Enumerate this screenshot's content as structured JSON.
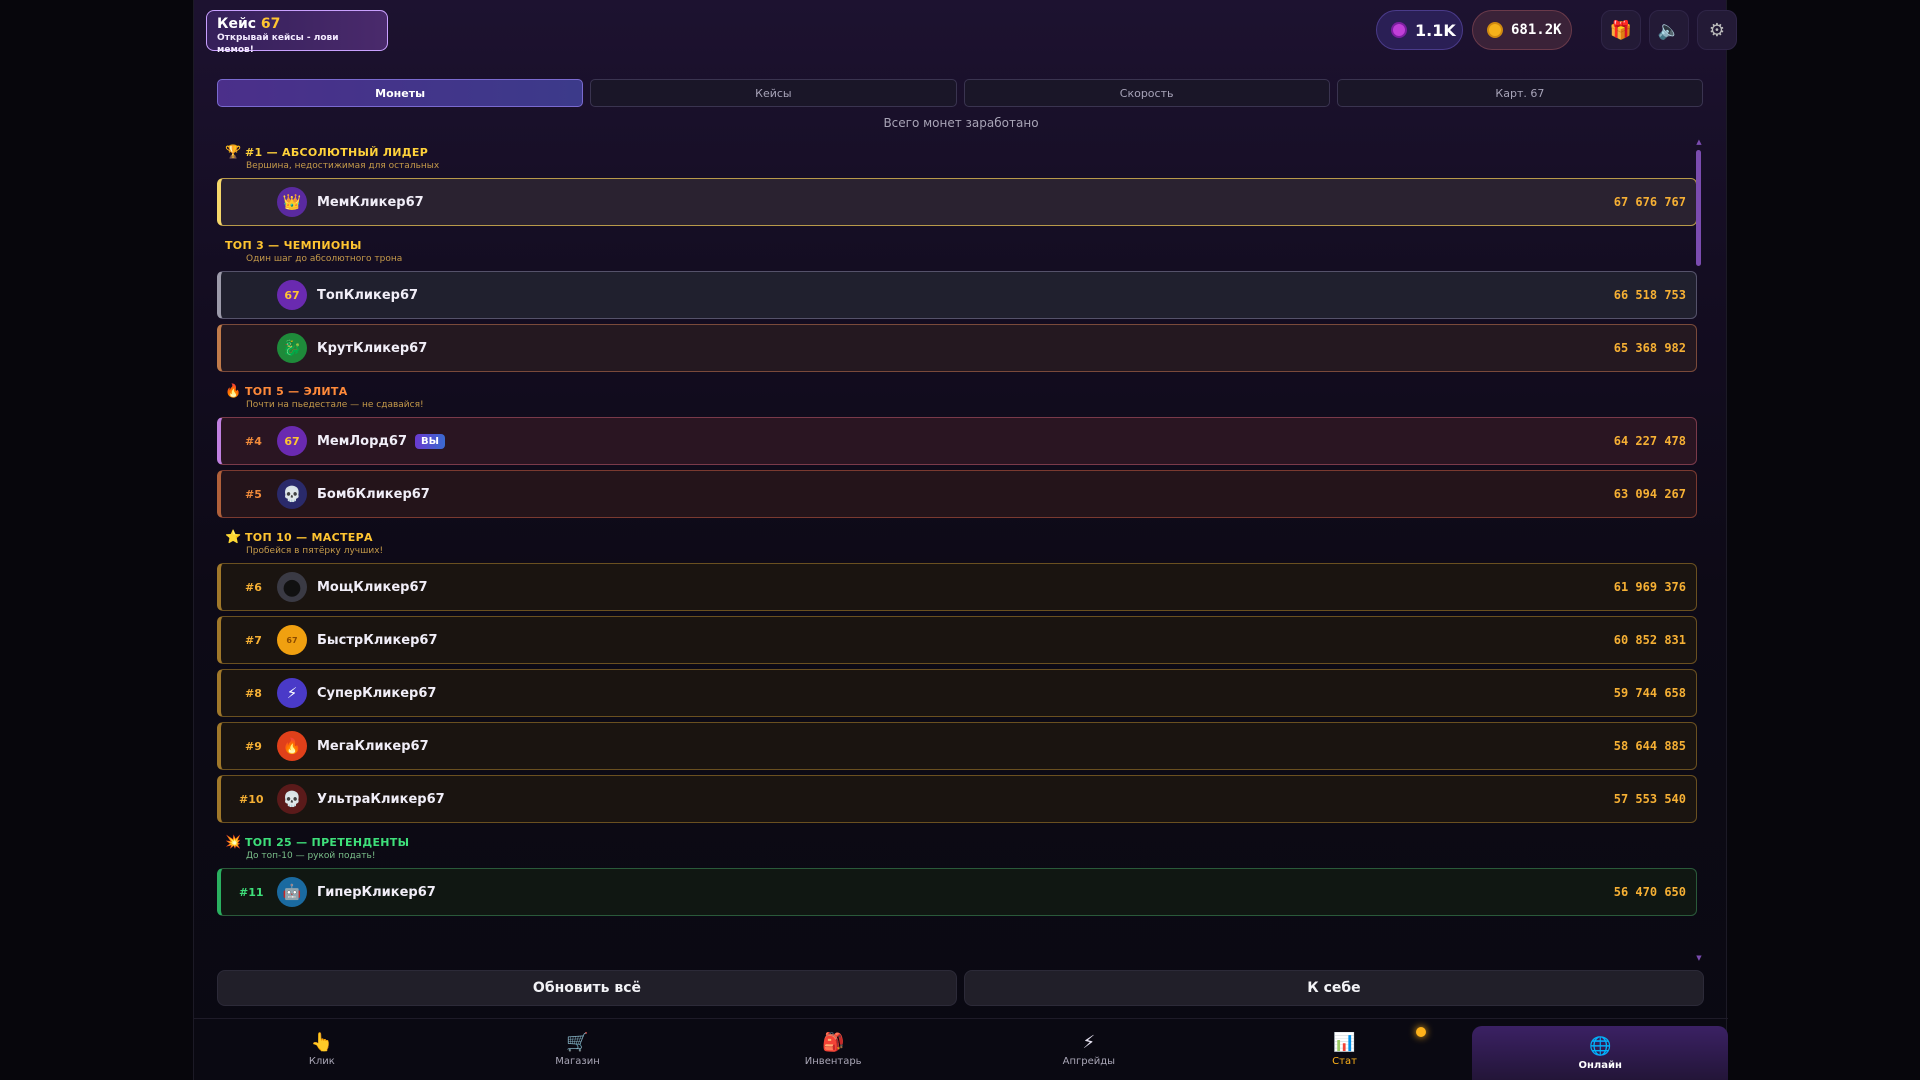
{
  "brand": {
    "title": "Кейс",
    "number": "67",
    "tagline": "Открывай кейсы - лови мемов!"
  },
  "header": {
    "gems": "1.1K",
    "coins": "681.2K"
  },
  "tabs": [
    {
      "label": "Монеты",
      "active": true
    },
    {
      "label": "Кейсы",
      "active": false
    },
    {
      "label": "Скорость",
      "active": false
    },
    {
      "label": "Карт. 67",
      "active": false
    }
  ],
  "subtitle": "Всего монет заработано",
  "groups": [
    {
      "title": "#1 — АБСОЛЮТНЫЙ ЛИДЕР",
      "subtitle": "Вершина, недостижимая для остальных",
      "icon": "trophy-icon",
      "color": "#ffd23a"
    },
    {
      "title": "ТОП 3 — ЧЕМПИОНЫ",
      "subtitle": "Один шаг до абсолютного трона",
      "icon": "",
      "color": "#ffc531"
    },
    {
      "title": "ТОП 5 — ЭЛИТА",
      "subtitle": "Почти на пьедестале — не сдавайся!",
      "icon": "fire-icon",
      "color": "#ff8a3a"
    },
    {
      "title": "ТОП 10 — МАСТЕРА",
      "subtitle": "Пробейся в пятёрку лучших!",
      "icon": "star-icon",
      "color": "#ffc531"
    },
    {
      "title": "ТОП 25 — ПРЕТЕНДЕНТЫ",
      "subtitle": "До топ-10 — рукой подать!",
      "icon": "burst-icon",
      "color": "#3ee07a"
    }
  ],
  "players": [
    {
      "rank": "",
      "name": "МемКликер67",
      "score": "67 676 767",
      "avatar": "👑",
      "avatar_bg": "#5a2aa0"
    },
    {
      "rank": "",
      "name": "ТопКликер67",
      "score": "66 518 753",
      "avatar": "67",
      "avatar_bg": "#6a2ab0"
    },
    {
      "rank": "",
      "name": "КрутКликер67",
      "score": "65 368 982",
      "avatar": "🐉",
      "avatar_bg": "#1e8a3a"
    },
    {
      "rank": "#4",
      "name": "МемЛорд67",
      "score": "64 227 478",
      "avatar": "67",
      "avatar_bg": "#6a2ab0",
      "you": "ВЫ"
    },
    {
      "rank": "#5",
      "name": "БомбКликер67",
      "score": "63 094 267",
      "avatar": "💀",
      "avatar_bg": "#2a2a6a"
    },
    {
      "rank": "#6",
      "name": "МощКликер67",
      "score": "61 969 376",
      "avatar": "●",
      "avatar_bg": "#3a3a44"
    },
    {
      "rank": "#7",
      "name": "БыстрКликер67",
      "score": "60 852 831",
      "avatar": "67",
      "avatar_bg": "#f0a010"
    },
    {
      "rank": "#8",
      "name": "СуперКликер67",
      "score": "59 744 658",
      "avatar": "⚡",
      "avatar_bg": "#4a3ac8"
    },
    {
      "rank": "#9",
      "name": "МегаКликер67",
      "score": "58 644 885",
      "avatar": "🔥",
      "avatar_bg": "#e0401a"
    },
    {
      "rank": "#10",
      "name": "УльтраКликер67",
      "score": "57 553 540",
      "avatar": "💀",
      "avatar_bg": "#5a1a1a"
    },
    {
      "rank": "#11",
      "name": "ГиперКликер67",
      "score": "56 470 650",
      "avatar": "🤖",
      "avatar_bg": "#1a6aa0"
    }
  ],
  "buttons": {
    "refresh": "Обновить всё",
    "to_self": "К себе"
  },
  "nav": [
    {
      "label": "Клик",
      "icon": "👆"
    },
    {
      "label": "Магазин",
      "icon": "🛒"
    },
    {
      "label": "Инвентарь",
      "icon": "🎒"
    },
    {
      "label": "Апгрейды",
      "icon": "⚡"
    },
    {
      "label": "Стат",
      "icon": "📊"
    },
    {
      "label": "Онлайн",
      "icon": "🌐",
      "active": true
    }
  ]
}
